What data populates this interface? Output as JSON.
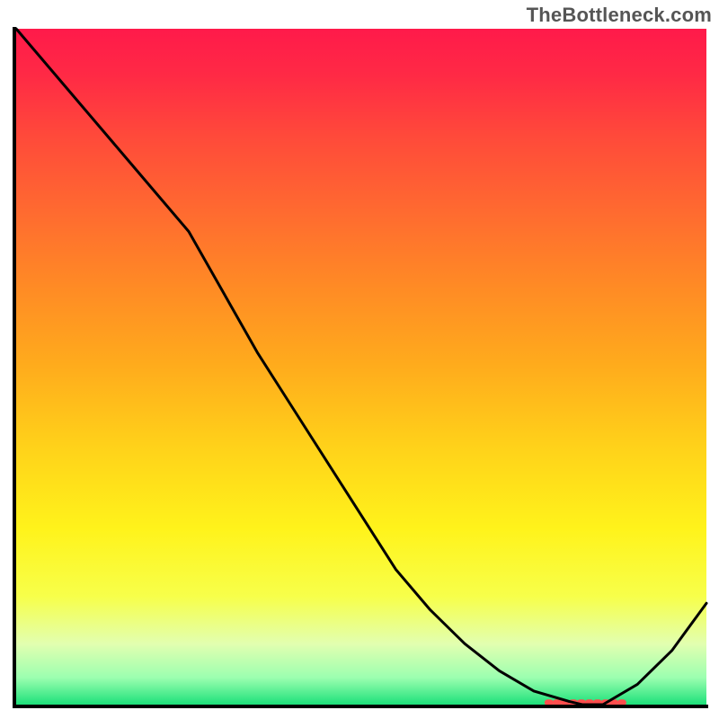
{
  "attribution": "TheBottleneck.com",
  "chart_data": {
    "type": "line",
    "title": "",
    "xlabel": "",
    "ylabel": "",
    "xlim": [
      0,
      1
    ],
    "ylim": [
      0,
      1
    ],
    "x": [
      0.0,
      0.05,
      0.1,
      0.15,
      0.2,
      0.25,
      0.3,
      0.35,
      0.4,
      0.45,
      0.5,
      0.55,
      0.6,
      0.65,
      0.7,
      0.75,
      0.8,
      0.82,
      0.85,
      0.9,
      0.95,
      1.0
    ],
    "values": [
      1.0,
      0.94,
      0.88,
      0.82,
      0.76,
      0.7,
      0.61,
      0.52,
      0.44,
      0.36,
      0.28,
      0.2,
      0.14,
      0.09,
      0.05,
      0.02,
      0.005,
      0.0,
      0.0,
      0.03,
      0.08,
      0.15
    ],
    "min_band_x": [
      0.77,
      0.88
    ],
    "gradient_stops": [
      {
        "offset": 0.0,
        "color": "#ff1a4a"
      },
      {
        "offset": 0.07,
        "color": "#ff2a45"
      },
      {
        "offset": 0.16,
        "color": "#ff4a3a"
      },
      {
        "offset": 0.27,
        "color": "#ff6a30"
      },
      {
        "offset": 0.38,
        "color": "#ff8a25"
      },
      {
        "offset": 0.5,
        "color": "#ffac1c"
      },
      {
        "offset": 0.62,
        "color": "#ffd21a"
      },
      {
        "offset": 0.74,
        "color": "#fff31b"
      },
      {
        "offset": 0.84,
        "color": "#f7ff4a"
      },
      {
        "offset": 0.91,
        "color": "#e2ffb0"
      },
      {
        "offset": 0.96,
        "color": "#9cffb0"
      },
      {
        "offset": 1.0,
        "color": "#1de07a"
      }
    ],
    "line_color": "#000000",
    "band_color": "#ff4d4d",
    "axis_color": "#000000",
    "axis_width": 4
  }
}
